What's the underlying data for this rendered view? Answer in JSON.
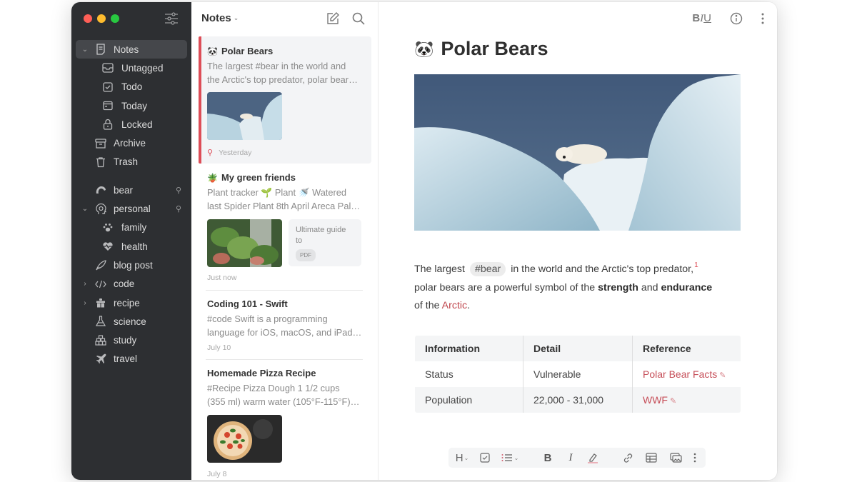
{
  "sidebar": {
    "window_controls": [
      "close",
      "minimize",
      "zoom"
    ],
    "filter_icon": "sliders-icon",
    "items": [
      {
        "label": "Notes",
        "icon": "note-icon",
        "expanded": true,
        "active": true
      },
      {
        "label": "Untagged",
        "icon": "inbox-icon"
      },
      {
        "label": "Todo",
        "icon": "checkbox-icon"
      },
      {
        "label": "Today",
        "icon": "calendar-icon"
      },
      {
        "label": "Locked",
        "icon": "lock-icon"
      },
      {
        "label": "Archive",
        "icon": "archive-icon"
      },
      {
        "label": "Trash",
        "icon": "trash-icon"
      }
    ],
    "tags": [
      {
        "label": "bear",
        "icon": "bear-icon",
        "pinned": true
      },
      {
        "label": "personal",
        "icon": "head-icon",
        "pinned": true,
        "expanded": true
      },
      {
        "label": "family",
        "icon": "paw-icon"
      },
      {
        "label": "health",
        "icon": "heart-pulse-icon"
      },
      {
        "label": "blog post",
        "icon": "feather-icon"
      },
      {
        "label": "code",
        "icon": "code-icon",
        "collapsed": true
      },
      {
        "label": "recipe",
        "icon": "gift-icon",
        "collapsed": true
      },
      {
        "label": "science",
        "icon": "flask-icon"
      },
      {
        "label": "study",
        "icon": "blocks-icon"
      },
      {
        "label": "travel",
        "icon": "airplane-icon"
      }
    ]
  },
  "notelist": {
    "title": "Notes",
    "compose_icon": "compose-icon",
    "search_icon": "search-icon",
    "notes": [
      {
        "emoji": "🐼",
        "title": "Polar Bears",
        "snippet": [
          "The largest #bear in the world and",
          "the Arctic's top predator, polar bear…"
        ],
        "date": "Yesterday",
        "pinned": true,
        "selected": true
      },
      {
        "emoji": "🪴",
        "title": "My green friends",
        "snippet": [
          "Plant tracker 🌱 Plant 🚿 Watered",
          "last Spider Plant 8th April Areca Pal…"
        ],
        "attachment": {
          "title": "Ultimate guide to",
          "type": "PDF"
        },
        "date": "Just now"
      },
      {
        "title": "Coding 101 - Swift",
        "snippet": [
          "#code Swift is a programming",
          "language for iOS, macOS, and iPad…"
        ],
        "date": "July 10"
      },
      {
        "title": "Homemade Pizza Recipe",
        "snippet": [
          "#Recipe Pizza Dough 1 1/2 cups",
          "(355 ml) warm water (105°F-115°F)…"
        ],
        "date": "July 8"
      }
    ]
  },
  "editor": {
    "toolbar": {
      "biu_b": "B",
      "biu_i": "I",
      "biu_u": "U",
      "info_icon": "info-icon",
      "more_icon": "more-vertical-icon"
    },
    "title_emoji": "🐼",
    "title": "Polar Bears",
    "paragraph": {
      "part1": "The largest",
      "hashtag": "#bear",
      "part2": "in the world and the Arctic's top predator,",
      "footnote": "1",
      "part3": "polar bears are a powerful symbol of the",
      "bold1": "strength",
      "part4": "and",
      "bold2": "endurance",
      "part5": "of the",
      "link": "Arctic",
      "part6": "."
    },
    "table": {
      "headers": [
        "Information",
        "Detail",
        "Reference"
      ],
      "rows": [
        [
          "Status",
          "Vulnerable",
          "Polar Bear Facts"
        ],
        [
          "Population",
          "22,000 - 31,000",
          "WWF"
        ]
      ]
    },
    "format_bar": {
      "heading": "H",
      "bold": "B",
      "italic": "I",
      "items": [
        "heading-icon",
        "checkbox-icon",
        "list-icon",
        "bold-icon",
        "italic-icon",
        "highlighter-icon",
        "link-icon",
        "table-icon",
        "image-icon",
        "more-vertical-icon"
      ]
    }
  },
  "colors": {
    "accent": "#dd4d57",
    "sidebar_bg": "#2d2f32",
    "link": "#c0464d"
  }
}
